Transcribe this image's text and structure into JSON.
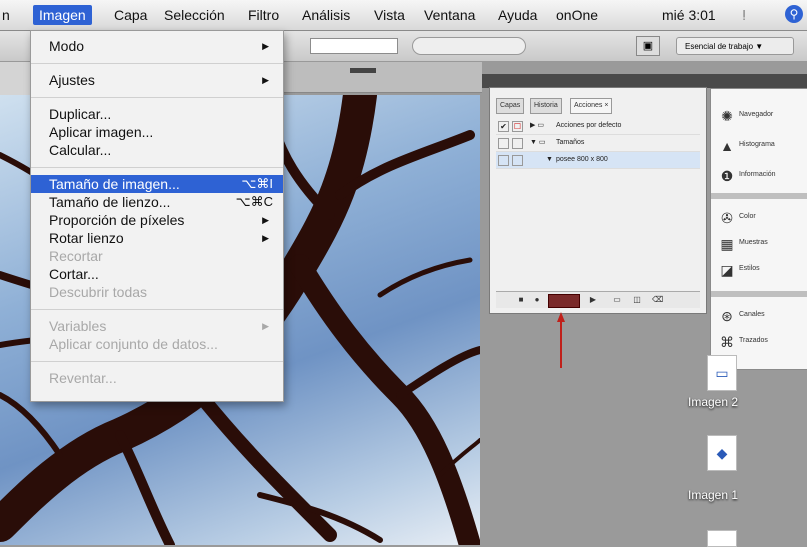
{
  "menubar": {
    "items": [
      "n",
      "Imagen",
      "Capa",
      "Selección",
      "Filtro",
      "Análisis",
      "Vista",
      "Ventana",
      "Ayuda",
      "onOne"
    ],
    "clock": "mié 3:01"
  },
  "optbar": {
    "workspace_label": "Esencial de trabajo ▼"
  },
  "imagen_menu": {
    "modo": "Modo",
    "ajustes": "Ajustes",
    "duplicar": "Duplicar...",
    "aplicar_imagen": "Aplicar imagen...",
    "calcular": "Calcular...",
    "tamano_imagen": "Tamaño de imagen...",
    "tamano_imagen_key": "⌥⌘I",
    "tamano_lienzo": "Tamaño de lienzo...",
    "tamano_lienzo_key": "⌥⌘C",
    "proporcion": "Proporción de píxeles",
    "rotar": "Rotar lienzo",
    "recortar": "Recortar",
    "cortar": "Cortar...",
    "descubrir": "Descubrir todas",
    "variables": "Variables",
    "aplicar_conjunto": "Aplicar conjunto de datos...",
    "reventar": "Reventar..."
  },
  "actions_panel": {
    "tabs": [
      "Capas",
      "Historia",
      "Acciones ×"
    ],
    "rows": [
      "Acciones por defecto",
      "Tamaños",
      "posee 800 x 800"
    ]
  },
  "icon_panel": {
    "items": [
      "Navegador",
      "Histograma",
      "Información",
      "Color",
      "Muestras",
      "Estilos",
      "Canales",
      "Trazados"
    ],
    "icons": [
      "navigator-icon",
      "histogram-icon",
      "info-icon",
      "color-icon",
      "swatches-icon",
      "styles-icon",
      "channels-icon",
      "paths-icon"
    ]
  },
  "desktop": {
    "file1": "Imagen 2",
    "file2": "Imagen 1"
  },
  "colors": {
    "menu_highlight": "#2e62d4",
    "arrow": "#c0201a"
  }
}
